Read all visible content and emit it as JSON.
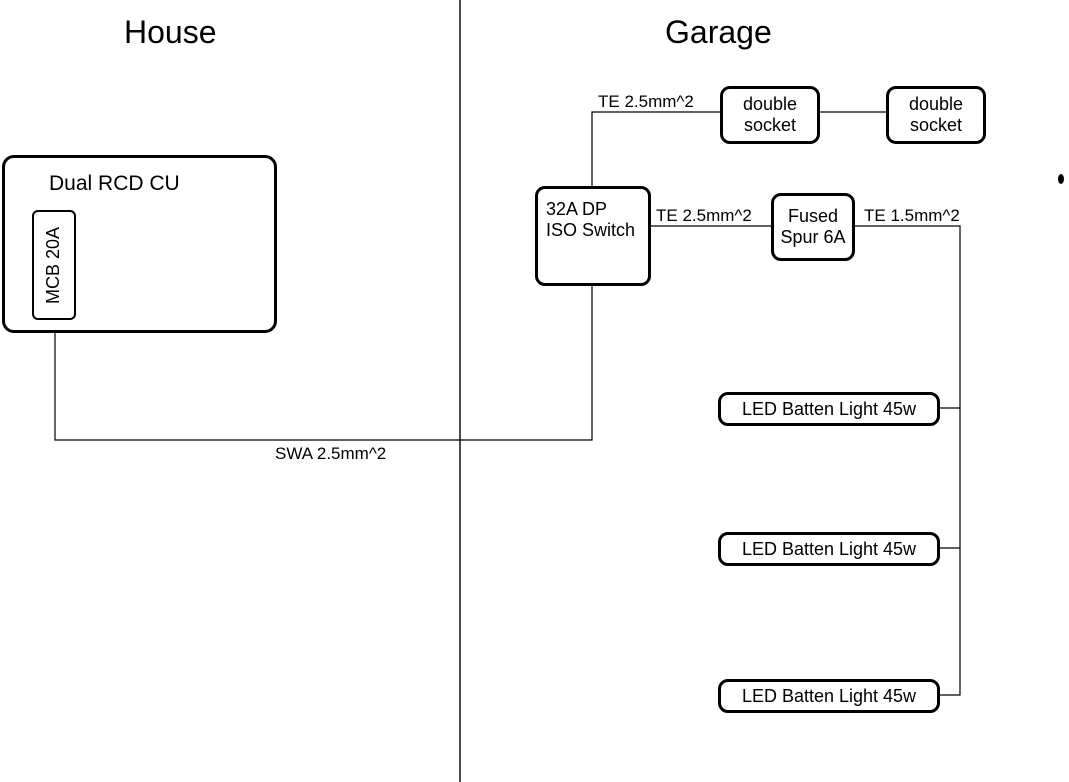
{
  "headings": {
    "house": "House",
    "garage": "Garage"
  },
  "components": {
    "cu": "Dual RCD CU",
    "mcb": "MCB 20A",
    "iso_switch_line1": "32A DP",
    "iso_switch_line2": "ISO Switch",
    "socket1_line1": "double",
    "socket1_line2": "socket",
    "socket2_line1": "double",
    "socket2_line2": "socket",
    "spur_line1": "Fused",
    "spur_line2": "Spur 6A",
    "light1": "LED Batten Light 45w",
    "light2": "LED Batten Light 45w",
    "light3": "LED Batten Light 45w"
  },
  "wires": {
    "swa": "SWA 2.5mm^2",
    "te25_top": "TE 2.5mm^2",
    "te25_mid": "TE 2.5mm^2",
    "te15": "TE 1.5mm^2"
  }
}
